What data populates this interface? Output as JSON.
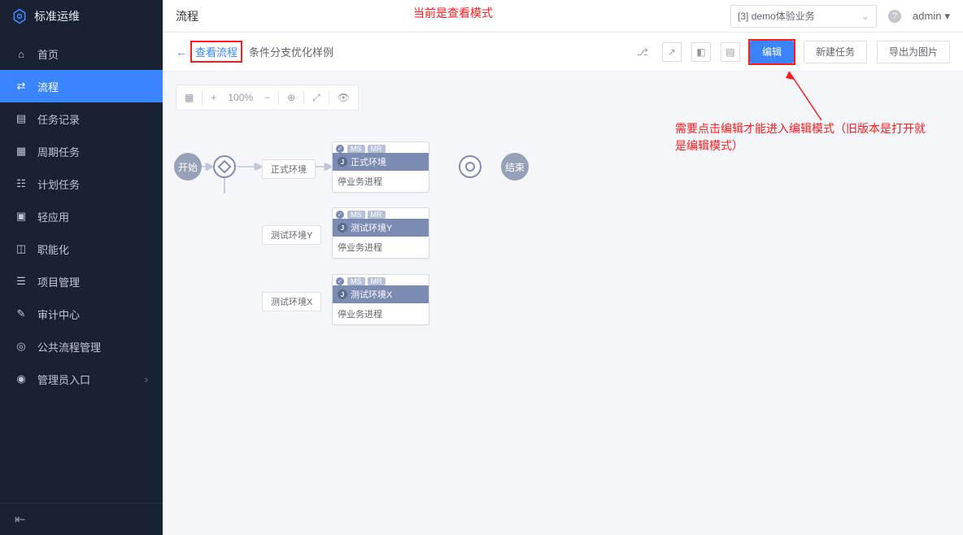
{
  "app": {
    "name": "标准运维"
  },
  "sidebar": {
    "items": [
      {
        "label": "首页",
        "icon": "home"
      },
      {
        "label": "流程",
        "icon": "flow",
        "active": true
      },
      {
        "label": "任务记录",
        "icon": "task"
      },
      {
        "label": "周期任务",
        "icon": "calendar"
      },
      {
        "label": "计划任务",
        "icon": "schedule"
      },
      {
        "label": "轻应用",
        "icon": "apps"
      },
      {
        "label": "职能化",
        "icon": "role"
      },
      {
        "label": "项目管理",
        "icon": "project"
      },
      {
        "label": "审计中心",
        "icon": "audit"
      },
      {
        "label": "公共流程管理",
        "icon": "public"
      },
      {
        "label": "管理员入口",
        "icon": "admin",
        "chevron": true
      }
    ]
  },
  "topbar": {
    "title": "流程",
    "biz": "[3] demo体验业务",
    "user": "admin"
  },
  "actionbar": {
    "crumb_view": "查看流程",
    "crumb_title": "条件分支优化样例",
    "edit": "编辑",
    "new_task": "新建任务",
    "export_img": "导出为图片",
    "zoom": "100%"
  },
  "annotations": {
    "top": "当前是查看模式",
    "mid": "需要点击编辑才能进入编辑模式（旧版本是打开就是编辑模式）"
  },
  "flow": {
    "start": "开始",
    "end": "结束",
    "branches": [
      "正式环境",
      "测试环境Y",
      "测试环境X"
    ],
    "tasks": [
      {
        "tags": [
          "MS",
          "MR"
        ],
        "title": "正式环境",
        "body": "停业务进程"
      },
      {
        "tags": [
          "MS",
          "MR"
        ],
        "title": "测试环境Y",
        "body": "停业务进程"
      },
      {
        "tags": [
          "MS",
          "MR"
        ],
        "title": "测试环境X",
        "body": "停业务进程"
      }
    ]
  }
}
